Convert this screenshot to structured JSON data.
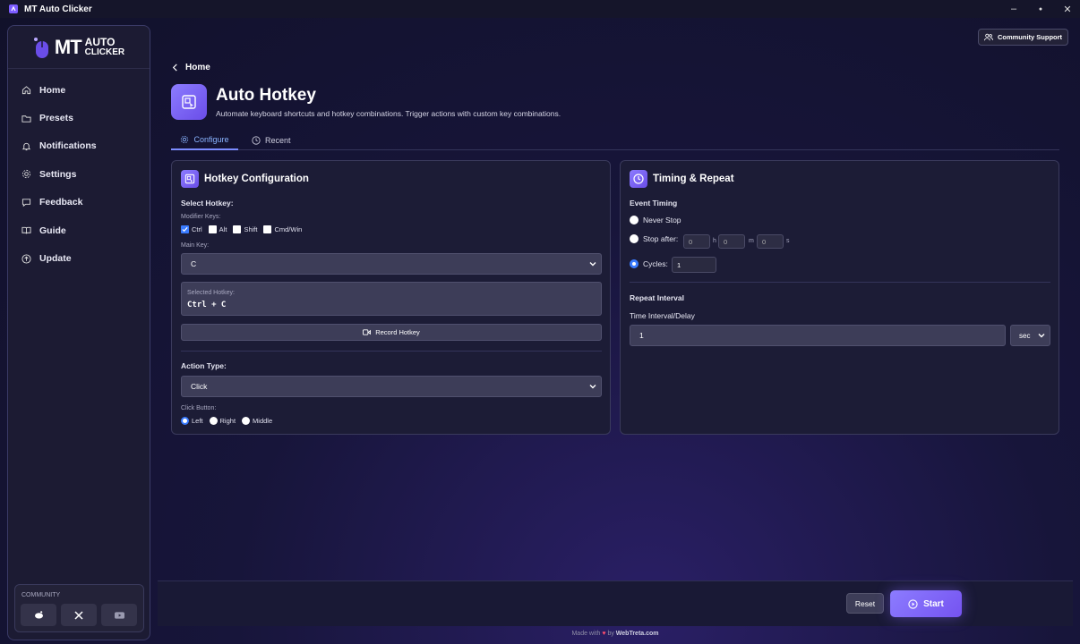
{
  "window": {
    "title": "MT Auto Clicker",
    "controls": [
      "–",
      "●",
      "✕"
    ]
  },
  "logo": {
    "mark": "MT",
    "line1": "AUTO",
    "line2": "CLICKER"
  },
  "sidebar": {
    "items": [
      {
        "label": "Home",
        "icon": "home-icon"
      },
      {
        "label": "Presets",
        "icon": "folder-icon"
      },
      {
        "label": "Notifications",
        "icon": "bell-icon"
      },
      {
        "label": "Settings",
        "icon": "gear-icon"
      },
      {
        "label": "Feedback",
        "icon": "message-icon"
      },
      {
        "label": "Guide",
        "icon": "book-icon"
      },
      {
        "label": "Update",
        "icon": "arrow-up-circle-icon"
      }
    ],
    "community_label": "COMMUNITY",
    "community_buttons": [
      "reddit-icon",
      "x-icon",
      "youtube-icon"
    ]
  },
  "header": {
    "support_label": "Community Support",
    "breadcrumb": "Home",
    "title": "Auto Hotkey",
    "subtitle": "Automate keyboard shortcuts and hotkey combinations. Trigger actions with custom key combinations."
  },
  "tabs": [
    {
      "label": "Configure",
      "active": true
    },
    {
      "label": "Recent",
      "active": false
    }
  ],
  "hotkey": {
    "title": "Hotkey Configuration",
    "select_label": "Select Hotkey:",
    "modifier_label": "Modifier Keys:",
    "modifiers": [
      {
        "label": "Ctrl",
        "checked": true
      },
      {
        "label": "Alt",
        "checked": false
      },
      {
        "label": "Shift",
        "checked": false
      },
      {
        "label": "Cmd/Win",
        "checked": false
      }
    ],
    "main_key_label": "Main Key:",
    "main_key_value": "C",
    "selected_label": "Selected Hotkey:",
    "selected_value": "Ctrl + C",
    "record_label": "Record Hotkey",
    "action_type_label": "Action Type:",
    "action_type_value": "Click",
    "click_button_label": "Click Button:",
    "click_buttons": [
      {
        "label": "Left",
        "selected": true
      },
      {
        "label": "Right",
        "selected": false
      },
      {
        "label": "Middle",
        "selected": false
      }
    ]
  },
  "timing": {
    "title": "Timing & Repeat",
    "event_timing_label": "Event Timing",
    "never_stop_label": "Never Stop",
    "stop_after_label": "Stop after:",
    "stop_after": {
      "h": "0",
      "m": "0",
      "s": "0",
      "h_unit": "h",
      "m_unit": "m",
      "s_unit": "s"
    },
    "cycles_label": "Cycles:",
    "cycles_value": "1",
    "mode": "cycles",
    "repeat_interval_label": "Repeat Interval",
    "interval_label": "Time Interval/Delay",
    "interval_value": "1",
    "interval_unit": "sec"
  },
  "actions": {
    "reset_label": "Reset",
    "start_label": "Start"
  },
  "footer": {
    "made_with": "Made with",
    "by": "by",
    "brand": "WebTreta.com"
  },
  "colors": {
    "accent": "#7c6cff",
    "link": "#8ab4ff",
    "radio": "#3a7bff"
  }
}
